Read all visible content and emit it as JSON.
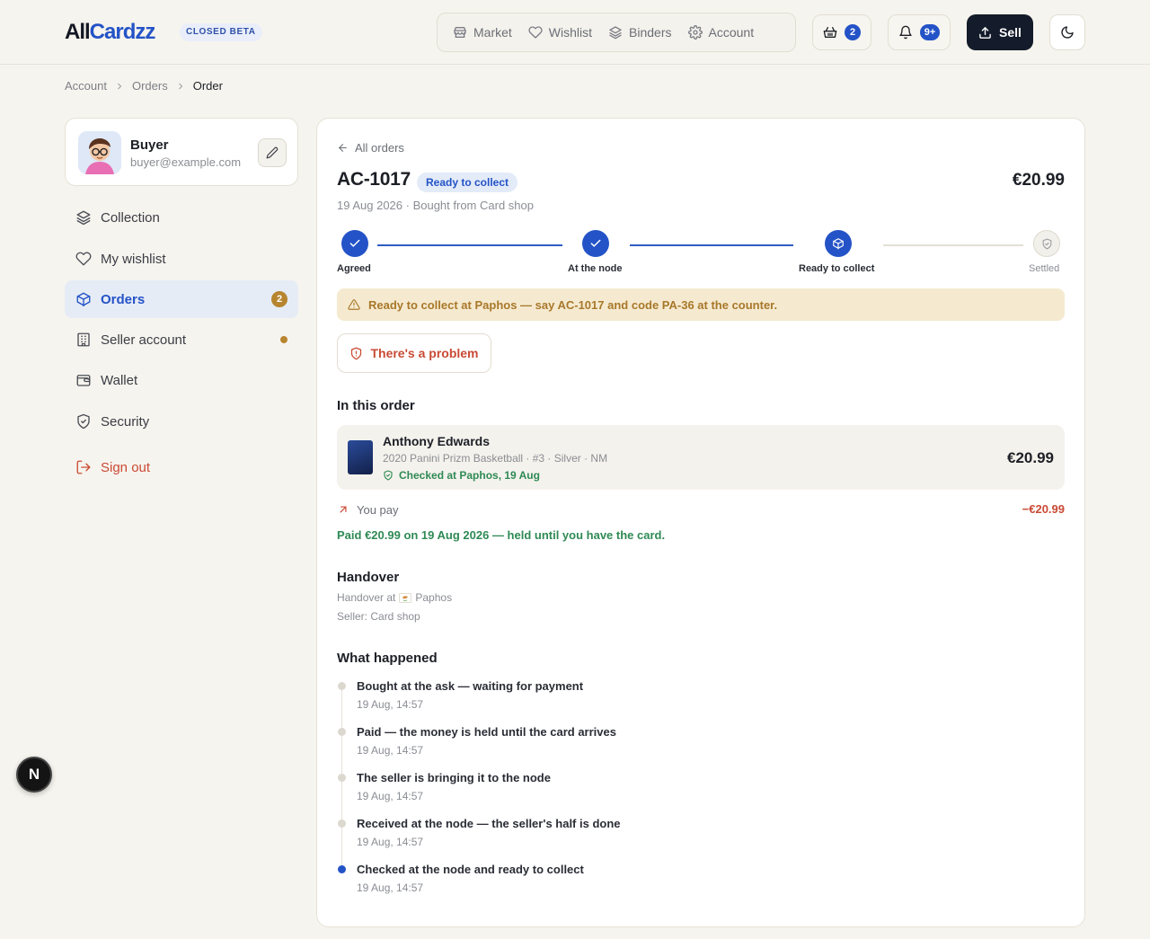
{
  "brand": {
    "logo_a": "All",
    "logo_b": "Cardzz",
    "badge": "CLOSED BETA"
  },
  "nav": [
    {
      "label": "Market",
      "icon": "store-icon"
    },
    {
      "label": "Wishlist",
      "icon": "heart-icon"
    },
    {
      "label": "Binders",
      "icon": "layers-icon"
    },
    {
      "label": "Account",
      "icon": "gear-icon"
    }
  ],
  "header": {
    "cart_count": "2",
    "notifications_count": "9+",
    "sell_label": "Sell"
  },
  "breadcrumb": [
    "Account",
    "Orders",
    "Order"
  ],
  "profile": {
    "name": "Buyer",
    "email": "buyer@example.com"
  },
  "sidebar": {
    "items": [
      {
        "label": "Collection",
        "icon": "layers-icon"
      },
      {
        "label": "My wishlist",
        "icon": "heart-icon"
      },
      {
        "label": "Orders",
        "icon": "box-icon",
        "badge": "2",
        "active": true
      },
      {
        "label": "Seller account",
        "icon": "building-icon"
      },
      {
        "label": "Wallet",
        "icon": "wallet-icon"
      },
      {
        "label": "Security",
        "icon": "shield-icon"
      },
      {
        "label": "Sign out",
        "icon": "logout-icon"
      }
    ]
  },
  "floating_badge": "N",
  "order": {
    "back_label": "All orders",
    "id": "AC-1017",
    "status": "Ready to collect",
    "total": "€20.99",
    "subline": "19 Aug 2026 · Bought from Card shop",
    "steps": [
      {
        "label": "Agreed",
        "done": true
      },
      {
        "label": "At the node",
        "done": true
      },
      {
        "label": "Ready to collect",
        "done": true
      },
      {
        "label": "Settled",
        "done": false
      }
    ],
    "alert": "Ready to collect at Paphos — say AC-1017 and code PA-36 at the counter.",
    "problem_label": "There's a problem",
    "items_title": "In this order",
    "item": {
      "name": "Anthony Edwards",
      "meta": "2020 Panini Prizm Basketball · #3 · Silver · NM",
      "check": "Checked at Paphos, 19 Aug",
      "price": "€20.99"
    },
    "pay_label": "You pay",
    "pay_amount": "−€20.99",
    "paid_note": "Paid €20.99 on 19 Aug 2026 — held until you have the card.",
    "handover_title": "Handover",
    "handover_prefix": "Handover at",
    "handover_place": "Paphos",
    "seller_line": "Seller: Card shop",
    "history_title": "What happened",
    "history": [
      {
        "title": "Bought at the ask — waiting for payment",
        "time": "19 Aug, 14:57"
      },
      {
        "title": "Paid — the money is held until the card arrives",
        "time": "19 Aug, 14:57"
      },
      {
        "title": "The seller is bringing it to the node",
        "time": "19 Aug, 14:57"
      },
      {
        "title": "Received at the node — the seller's half is done",
        "time": "19 Aug, 14:57"
      },
      {
        "title": "Checked at the node and ready to collect",
        "time": "19 Aug, 14:57"
      }
    ]
  },
  "colors": {
    "accent": "#2453c7",
    "warning": "#a8782a",
    "success": "#2f8a55",
    "danger": "#c94a34"
  }
}
